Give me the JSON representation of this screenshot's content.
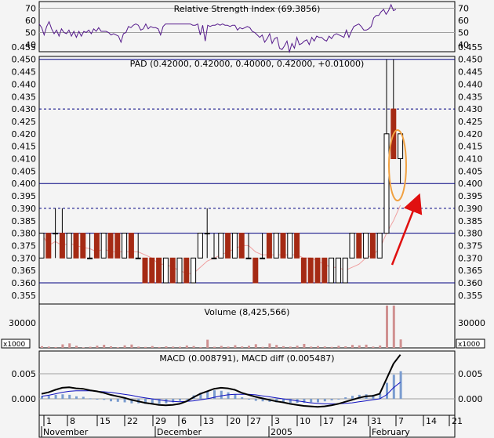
{
  "chart_data": [
    {
      "type": "line",
      "title": "Relative Strength Index (69.3856)",
      "ylim": [
        30,
        75
      ],
      "yticks": [
        "70",
        "60",
        "50",
        "40"
      ],
      "reference_levels": [
        70,
        50
      ],
      "series": [
        {
          "values": [
            57,
            54,
            48,
            55,
            59,
            53,
            49,
            52,
            47,
            53,
            50,
            49,
            52,
            47,
            51,
            46,
            51,
            47,
            51,
            50,
            52,
            49,
            53,
            51,
            54,
            51,
            51,
            51,
            50,
            48,
            49,
            48,
            47,
            42,
            49,
            50,
            55,
            54,
            56,
            57,
            56,
            52,
            53,
            57,
            53,
            55,
            54,
            54,
            53,
            48,
            55,
            57,
            57,
            57,
            57,
            57,
            57,
            57,
            57,
            57,
            57,
            57,
            56,
            56,
            57,
            48,
            56,
            43,
            56,
            55,
            56,
            56,
            57,
            56,
            57,
            56,
            56,
            55,
            56,
            56,
            52,
            54,
            53,
            54,
            55,
            54,
            51,
            50,
            48,
            46,
            48,
            42,
            45,
            49,
            41,
            45,
            46,
            37,
            36,
            39,
            43,
            34,
            41,
            37,
            46,
            40,
            41,
            43,
            44,
            40,
            46,
            43,
            47,
            46,
            46,
            44,
            43,
            47,
            45,
            48,
            49,
            48,
            47,
            46,
            52,
            46,
            51,
            55,
            56,
            57,
            55,
            52,
            52,
            53,
            55,
            62,
            64,
            64,
            67,
            69,
            65,
            68,
            73,
            68,
            69
          ]
        }
      ]
    },
    {
      "type": "candlestick",
      "title": "PAD (0.42000, 0.42000, 0.40000, 0.42000, +0.01000)",
      "ylim": [
        0.353,
        0.455
      ],
      "yticks": [
        "0.455",
        "0.450",
        "0.445",
        "0.440",
        "0.435",
        "0.430",
        "0.425",
        "0.420",
        "0.415",
        "0.410",
        "0.405",
        "0.400",
        "0.395",
        "0.390",
        "0.385",
        "0.380",
        "0.375",
        "0.370",
        "0.365",
        "0.360",
        "0.355"
      ],
      "solid_levels": [
        0.45,
        0.4,
        0.38,
        0.36
      ],
      "dashed_levels": [
        0.43,
        0.39
      ],
      "ohlc": [
        [
          0.37,
          0.38,
          0.37,
          0.38
        ],
        [
          0.38,
          0.38,
          0.37,
          0.37
        ],
        [
          0.38,
          0.39,
          0.37,
          0.38
        ],
        [
          0.38,
          0.39,
          0.37,
          0.37
        ],
        [
          0.37,
          0.38,
          0.37,
          0.38
        ],
        [
          0.38,
          0.38,
          0.37,
          0.37
        ],
        [
          0.38,
          0.38,
          0.37,
          0.37
        ],
        [
          0.37,
          0.38,
          0.37,
          0.37
        ],
        [
          0.38,
          0.38,
          0.37,
          0.37
        ],
        [
          0.37,
          0.38,
          0.37,
          0.38
        ],
        [
          0.38,
          0.38,
          0.37,
          0.37
        ],
        [
          0.38,
          0.38,
          0.37,
          0.37
        ],
        [
          0.37,
          0.38,
          0.37,
          0.38
        ],
        [
          0.38,
          0.38,
          0.37,
          0.37
        ],
        [
          0.37,
          0.38,
          0.37,
          0.37
        ],
        [
          0.37,
          0.37,
          0.36,
          0.36
        ],
        [
          0.37,
          0.37,
          0.36,
          0.36
        ],
        [
          0.37,
          0.37,
          0.36,
          0.36
        ],
        [
          0.36,
          0.37,
          0.36,
          0.37
        ],
        [
          0.37,
          0.37,
          0.36,
          0.36
        ],
        [
          0.36,
          0.37,
          0.36,
          0.37
        ],
        [
          0.37,
          0.37,
          0.36,
          0.36
        ],
        [
          0.36,
          0.37,
          0.36,
          0.37
        ],
        [
          0.37,
          0.38,
          0.37,
          0.38
        ],
        [
          0.38,
          0.39,
          0.37,
          0.38
        ],
        [
          0.37,
          0.38,
          0.37,
          0.37
        ],
        [
          0.37,
          0.38,
          0.37,
          0.38
        ],
        [
          0.38,
          0.38,
          0.37,
          0.37
        ],
        [
          0.37,
          0.38,
          0.37,
          0.38
        ],
        [
          0.38,
          0.38,
          0.37,
          0.37
        ],
        [
          0.37,
          0.38,
          0.37,
          0.37
        ],
        [
          0.37,
          0.37,
          0.36,
          0.36
        ],
        [
          0.37,
          0.38,
          0.37,
          0.37
        ],
        [
          0.38,
          0.38,
          0.37,
          0.37
        ],
        [
          0.37,
          0.38,
          0.37,
          0.38
        ],
        [
          0.38,
          0.38,
          0.37,
          0.37
        ],
        [
          0.37,
          0.38,
          0.37,
          0.38
        ],
        [
          0.38,
          0.38,
          0.37,
          0.37
        ],
        [
          0.37,
          0.37,
          0.36,
          0.36
        ],
        [
          0.37,
          0.37,
          0.36,
          0.36
        ],
        [
          0.37,
          0.37,
          0.36,
          0.36
        ],
        [
          0.37,
          0.37,
          0.36,
          0.36
        ],
        [
          0.36,
          0.37,
          0.36,
          0.37
        ],
        [
          0.36,
          0.37,
          0.36,
          0.37
        ],
        [
          0.36,
          0.37,
          0.36,
          0.37
        ],
        [
          0.37,
          0.38,
          0.37,
          0.38
        ],
        [
          0.38,
          0.38,
          0.37,
          0.37
        ],
        [
          0.37,
          0.38,
          0.37,
          0.38
        ],
        [
          0.38,
          0.38,
          0.37,
          0.37
        ],
        [
          0.37,
          0.38,
          0.37,
          0.38
        ],
        [
          0.38,
          0.45,
          0.38,
          0.42
        ],
        [
          0.43,
          0.45,
          0.41,
          0.41
        ],
        [
          0.41,
          0.42,
          0.4,
          0.42
        ]
      ]
    },
    {
      "type": "bar",
      "title": "Volume (8,425,566)",
      "unit": "x1000",
      "yticks": [
        "30000"
      ],
      "values": [
        1200,
        900,
        600,
        2500,
        3200,
        1500,
        400,
        800,
        1600,
        2200,
        1100,
        500,
        1800,
        2400,
        900,
        700,
        1300,
        600,
        1100,
        900,
        800,
        1700,
        1300,
        600,
        5800,
        800,
        1400,
        900,
        1900,
        1000,
        1500,
        2600,
        700,
        3100,
        2100,
        1200,
        900,
        1600,
        2800,
        900,
        1300,
        1000,
        700,
        1500,
        1100,
        2100,
        1800,
        2300,
        900,
        1700,
        37000,
        30000,
        6000
      ]
    },
    {
      "type": "line",
      "title": "MACD (0.008791), MACD diff (0.005487)",
      "ylim": [
        -0.004,
        0.0095
      ],
      "yticks": [
        "0.005",
        "0.000"
      ],
      "series": [
        {
          "values": [
            0.001,
            0.0013,
            0.0018,
            0.0022,
            0.0023,
            0.0021,
            0.002,
            0.0017,
            0.0015,
            0.0012,
            0.0008,
            0.0005,
            0.0002,
            -0.0002,
            -0.0005,
            -0.0008,
            -0.001,
            -0.0012,
            -0.0013,
            -0.0012,
            -0.001,
            -0.0005,
            0.0003,
            0.001,
            0.0015,
            0.002,
            0.0022,
            0.0021,
            0.0018,
            0.0012,
            0.0008,
            0.0004,
            0.0001,
            -0.0002,
            -0.0005,
            -0.0007,
            -0.001,
            -0.0012,
            -0.0014,
            -0.0015,
            -0.0016,
            -0.0015,
            -0.0013,
            -0.001,
            -0.0006,
            -0.0002,
            0.0002,
            0.0005,
            0.0006,
            0.001,
            0.004,
            0.007,
            0.0088
          ]
        },
        {
          "values": [
            0.0005,
            0.0007,
            0.001,
            0.0013,
            0.0015,
            0.0016,
            0.0016,
            0.0016,
            0.0015,
            0.0014,
            0.0013,
            0.0011,
            0.0009,
            0.0007,
            0.0004,
            0.0002,
            0.0,
            -0.0002,
            -0.0004,
            -0.0005,
            -0.0006,
            -0.0005,
            -0.0004,
            -0.0002,
            0.0,
            0.0003,
            0.0006,
            0.0008,
            0.0009,
            0.0009,
            0.0009,
            0.0008,
            0.0006,
            0.0004,
            0.0002,
            0.0,
            -0.0002,
            -0.0004,
            -0.0006,
            -0.0008,
            -0.0009,
            -0.001,
            -0.001,
            -0.001,
            -0.0009,
            -0.0008,
            -0.0006,
            -0.0004,
            -0.0002,
            0.0,
            0.0008,
            0.0022,
            0.0033
          ]
        }
      ],
      "histogram": [
        0.0005,
        0.0006,
        0.0008,
        0.0009,
        0.0008,
        0.0005,
        0.0004,
        0.0001,
        0.0,
        -0.0002,
        -0.0005,
        -0.0006,
        -0.0007,
        -0.0009,
        -0.0009,
        -0.001,
        -0.001,
        -0.001,
        -0.0009,
        -0.0007,
        -0.0004,
        0.0,
        0.0007,
        0.0012,
        0.0015,
        0.0017,
        0.0016,
        0.0013,
        0.0009,
        0.0003,
        -0.0001,
        -0.0004,
        -0.0005,
        -0.0006,
        -0.0007,
        -0.0007,
        -0.0008,
        -0.0008,
        -0.0008,
        -0.0007,
        -0.0007,
        -0.0005,
        -0.0003,
        0.0,
        0.0003,
        0.0006,
        0.0008,
        0.0009,
        0.0008,
        0.001,
        0.0032,
        0.0048,
        0.0055
      ]
    }
  ],
  "x_axis": {
    "day_ticks": [
      "1",
      "8",
      "15",
      "22",
      "29",
      "6",
      "13",
      "20",
      "27",
      "3",
      "10",
      "17",
      "24",
      "31",
      "7",
      "14",
      "21"
    ],
    "months": [
      "November",
      "December",
      "2005",
      "February"
    ]
  },
  "colors": {
    "down": "#a52a14",
    "up": "#ffffff",
    "rsi": "#551a8b",
    "macd": "#000000",
    "signal": "#1010c0",
    "level": "#000080",
    "volume": "#d09090",
    "histogram": "#7a9ccf",
    "annotation_ellipse": "#f0a040",
    "annotation_arrow": "#e01010"
  }
}
